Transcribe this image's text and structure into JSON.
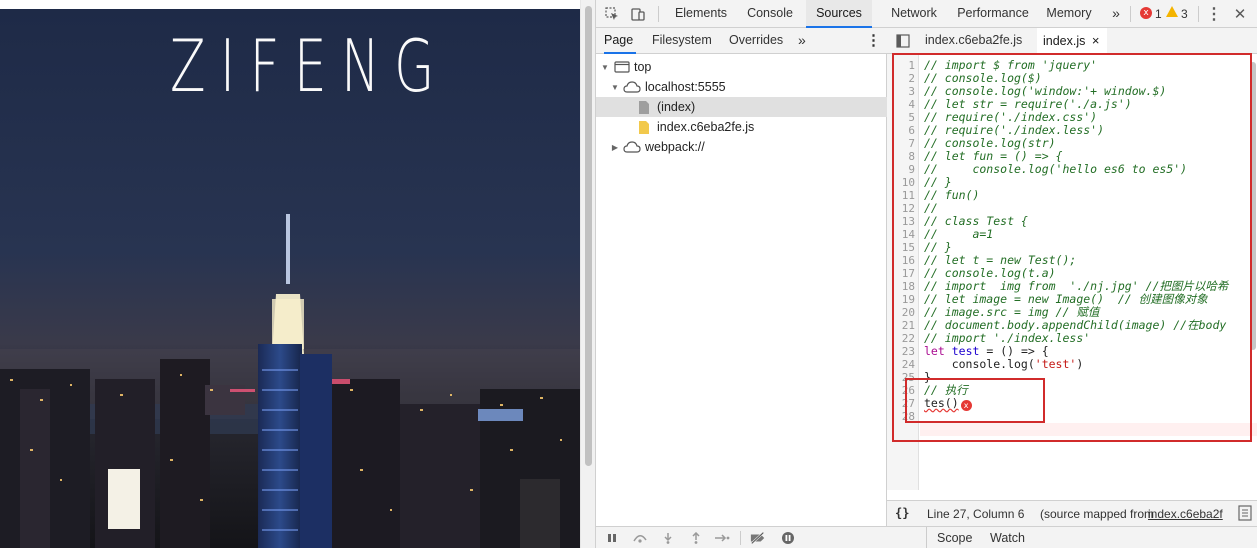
{
  "page": {
    "title": "ZIFENG"
  },
  "devtools": {
    "main_tabs": [
      "Elements",
      "Console",
      "Sources",
      "Network",
      "Performance",
      "Memory"
    ],
    "active_main_tab": "Sources",
    "more_tabs_glyph": "»",
    "error_count": "1",
    "warning_count": "3",
    "navigator": {
      "tabs": [
        "Page",
        "Filesystem",
        "Overrides"
      ],
      "active_tab": "Page",
      "more_glyph": "»",
      "tree": {
        "top": "top",
        "host": "localhost:5555",
        "index": "(index)",
        "bundle": "index.c6eba2fe.js",
        "webpack": "webpack://"
      }
    },
    "editor": {
      "tabs": [
        {
          "label": "index.c6eba2fe.js",
          "active": false
        },
        {
          "label": "index.js",
          "active": true
        }
      ],
      "close_glyph": "×",
      "lines": [
        "// import $ from 'jquery'",
        "// console.log($)",
        "// console.log('window:'+ window.$)",
        "// let str = require('./a.js')",
        "// require('./index.css')",
        "// require('./index.less')",
        "// console.log(str)",
        "// let fun = () => {",
        "//     console.log('hello es6 to es5')",
        "// }",
        "// fun()",
        "//",
        "// class Test {",
        "//     a=1",
        "// }",
        "// let t = new Test();",
        "// console.log(t.a)",
        "// import  img from  './nj.jpg' //把图片以哈希",
        "// let image = new Image()  // 创建图像对象",
        "// image.src = img // 赋值",
        "// document.body.appendChild(image) //在body",
        "// import './index.less'",
        "let test = () => {",
        "    console.log('test')",
        "}",
        "// 执行",
        "tes()",
        ""
      ],
      "code_tokens": {
        "let": "let",
        "test_name": "test",
        "arrow": " = () => {",
        "console_call": "    console.log(",
        "test_string": "'test'",
        "close_paren": ")",
        "close_brace": "}",
        "call": "tes()"
      },
      "error_marker": "x"
    },
    "status": {
      "format_glyph": "{}",
      "position": "Line 27, Column 6",
      "source_prefix": "(source mapped from ",
      "source_link": "index.c6eba2f"
    },
    "debugger": {
      "tabs": [
        "Scope",
        "Watch"
      ]
    }
  }
}
